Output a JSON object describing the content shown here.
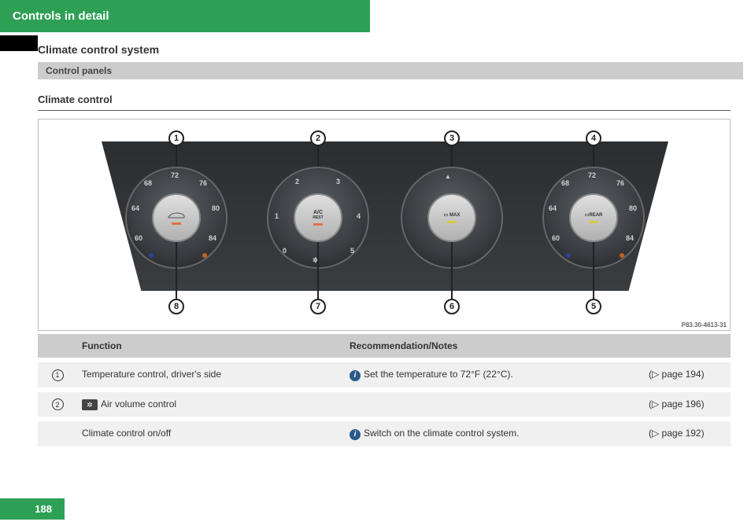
{
  "header": {
    "title": "Controls in detail"
  },
  "section": {
    "title": "Climate control system"
  },
  "subsection_bar": {
    "label": "Control panels"
  },
  "subheading": {
    "label": "Climate control"
  },
  "figure": {
    "ref": "P83.30-4613-31",
    "callouts_top": [
      "1",
      "2",
      "3",
      "4"
    ],
    "callouts_bottom": [
      "8",
      "7",
      "6",
      "5"
    ],
    "dial_temp_ticks": [
      "72",
      "68",
      "76",
      "64",
      "80",
      "60",
      "84"
    ],
    "dial_fan_ticks": [
      "0",
      "1",
      "2",
      "3",
      "4",
      "5"
    ],
    "dial2_center_top": "A/C",
    "dial2_center_bottom": "REST",
    "dial3_text": "MAX",
    "dial4_text": "REAR"
  },
  "table": {
    "headers": {
      "function": "Function",
      "notes": "Recommendation/Notes"
    },
    "rows": [
      {
        "num": "1",
        "func": "Temperature control, driver's side",
        "note_icon": true,
        "note": "Set the temperature to 72°F (22°C).",
        "page": "(▷ page 194)"
      },
      {
        "num": "2",
        "func_badge": "✲",
        "func": "Air volume control",
        "note_icon": false,
        "note": "",
        "page": "(▷ page 196)"
      },
      {
        "num": "",
        "func": "Climate control on/off",
        "note_icon": true,
        "note": "Switch on the climate control system.",
        "page": "(▷ page 192)"
      }
    ]
  },
  "page_number": "188"
}
